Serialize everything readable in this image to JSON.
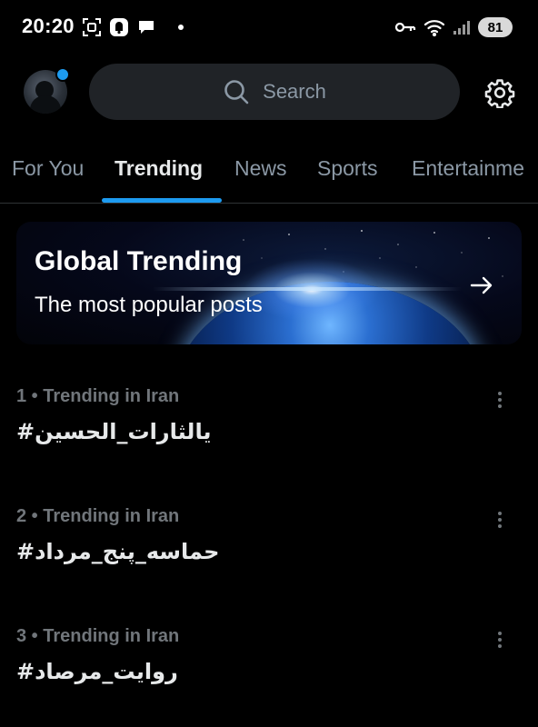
{
  "status_bar": {
    "time": "20:20",
    "left_icons": [
      "scan-icon",
      "notification-app-icon",
      "chat-bubble-icon",
      "dot-icon"
    ],
    "right_icons": [
      "key-icon",
      "wifi-icon",
      "signal-icon"
    ],
    "battery": "81"
  },
  "header": {
    "avatar_badge_color": "#1d9bf0",
    "search_placeholder": "Search",
    "search_icon": "search-icon",
    "settings_icon": "gear-icon"
  },
  "tabs": [
    {
      "label": "For You",
      "active": false
    },
    {
      "label": "Trending",
      "active": true
    },
    {
      "label": "News",
      "active": false
    },
    {
      "label": "Sports",
      "active": false
    },
    {
      "label": "Entertainme",
      "active": false
    }
  ],
  "banner": {
    "title": "Global Trending",
    "subtitle": "The most popular posts",
    "action_icon": "arrow-right-icon"
  },
  "trends": [
    {
      "meta": "1 • Trending in Iran",
      "name": "#يالثارات_الحسين"
    },
    {
      "meta": "2 • Trending in Iran",
      "name": "#حماسه_پنج_مرداد"
    },
    {
      "meta": "3 • Trending in Iran",
      "name": "#روایت_مرصاد"
    }
  ],
  "colors": {
    "background": "#000000",
    "accent": "#1d9bf0",
    "text_primary": "#e7e9ea",
    "text_secondary": "#71767b",
    "search_bg": "#202327"
  }
}
